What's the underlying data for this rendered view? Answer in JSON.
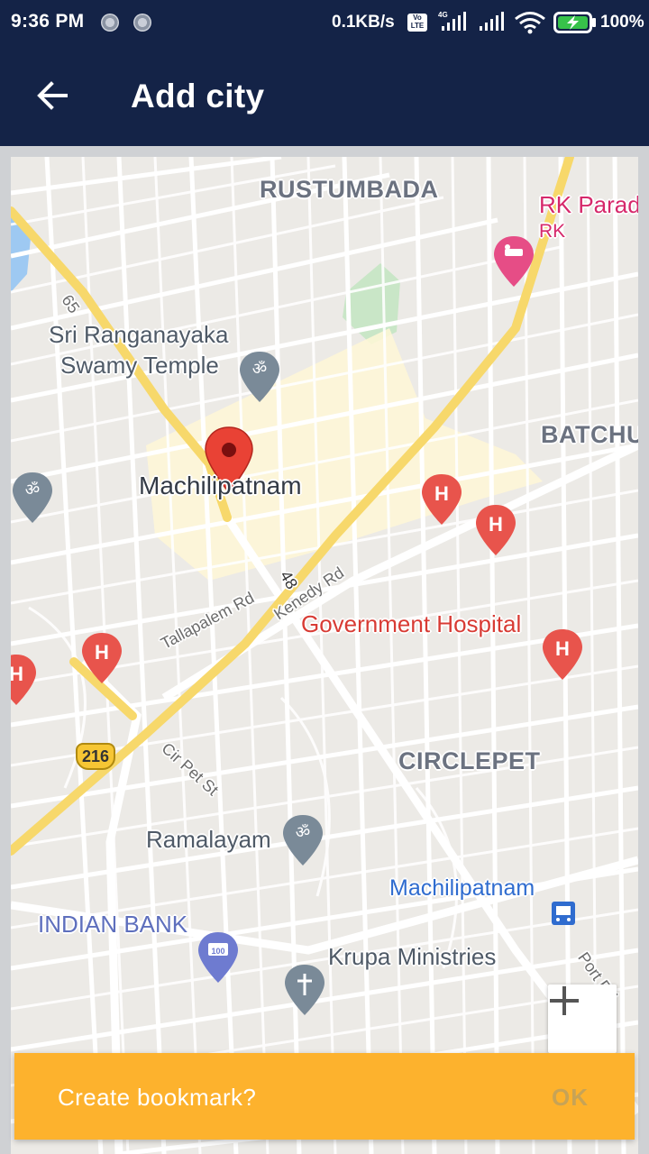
{
  "status_bar": {
    "time": "9:36 PM",
    "network_speed": "0.1KB/s",
    "volte": "Vo LTE",
    "network_type": "4G",
    "battery": "100%"
  },
  "app_bar": {
    "title": "Add city",
    "back_icon": "arrow-left-icon"
  },
  "map": {
    "areas": [
      "RUSTUMBADA",
      "BATCHU",
      "CIRCLEPET"
    ],
    "selected_city": "Machilipatnam",
    "places": {
      "rk_parade": "RK Parad",
      "rk_sub": "RK",
      "temple_line1": "Sri Ranganayaka",
      "temple_line2": "Swamy Temple",
      "government_hospital": "Government Hospital",
      "ramalayam": "Ramalayam",
      "indian_bank": "INDIAN BANK",
      "krupa": "Krupa Ministries",
      "bus_station": "Machilipatnam"
    },
    "roads": {
      "road_65": "65",
      "road_48": "48",
      "tallapalem": "Tallapalem Rd",
      "kenedy": "Kenedy Rd",
      "cir_pet": "Cir Pet St",
      "port": "Port Rd"
    },
    "route_shield": "216",
    "marker_icons": [
      "om-temple-icon",
      "hospital-icon",
      "hotel-icon",
      "atm-icon",
      "church-icon",
      "bus-icon"
    ],
    "colors": {
      "highway": "#f7d86b",
      "hospital_marker": "#e8544c",
      "temple_marker": "#7a8a98",
      "hotel_marker": "#e64d86"
    }
  },
  "zoom_control": {
    "zoom_in": "+"
  },
  "snackbar": {
    "message": "Create bookmark?",
    "action": "OK"
  },
  "colors": {
    "app_bar": "#142347",
    "snackbar": "#fdb22d"
  }
}
